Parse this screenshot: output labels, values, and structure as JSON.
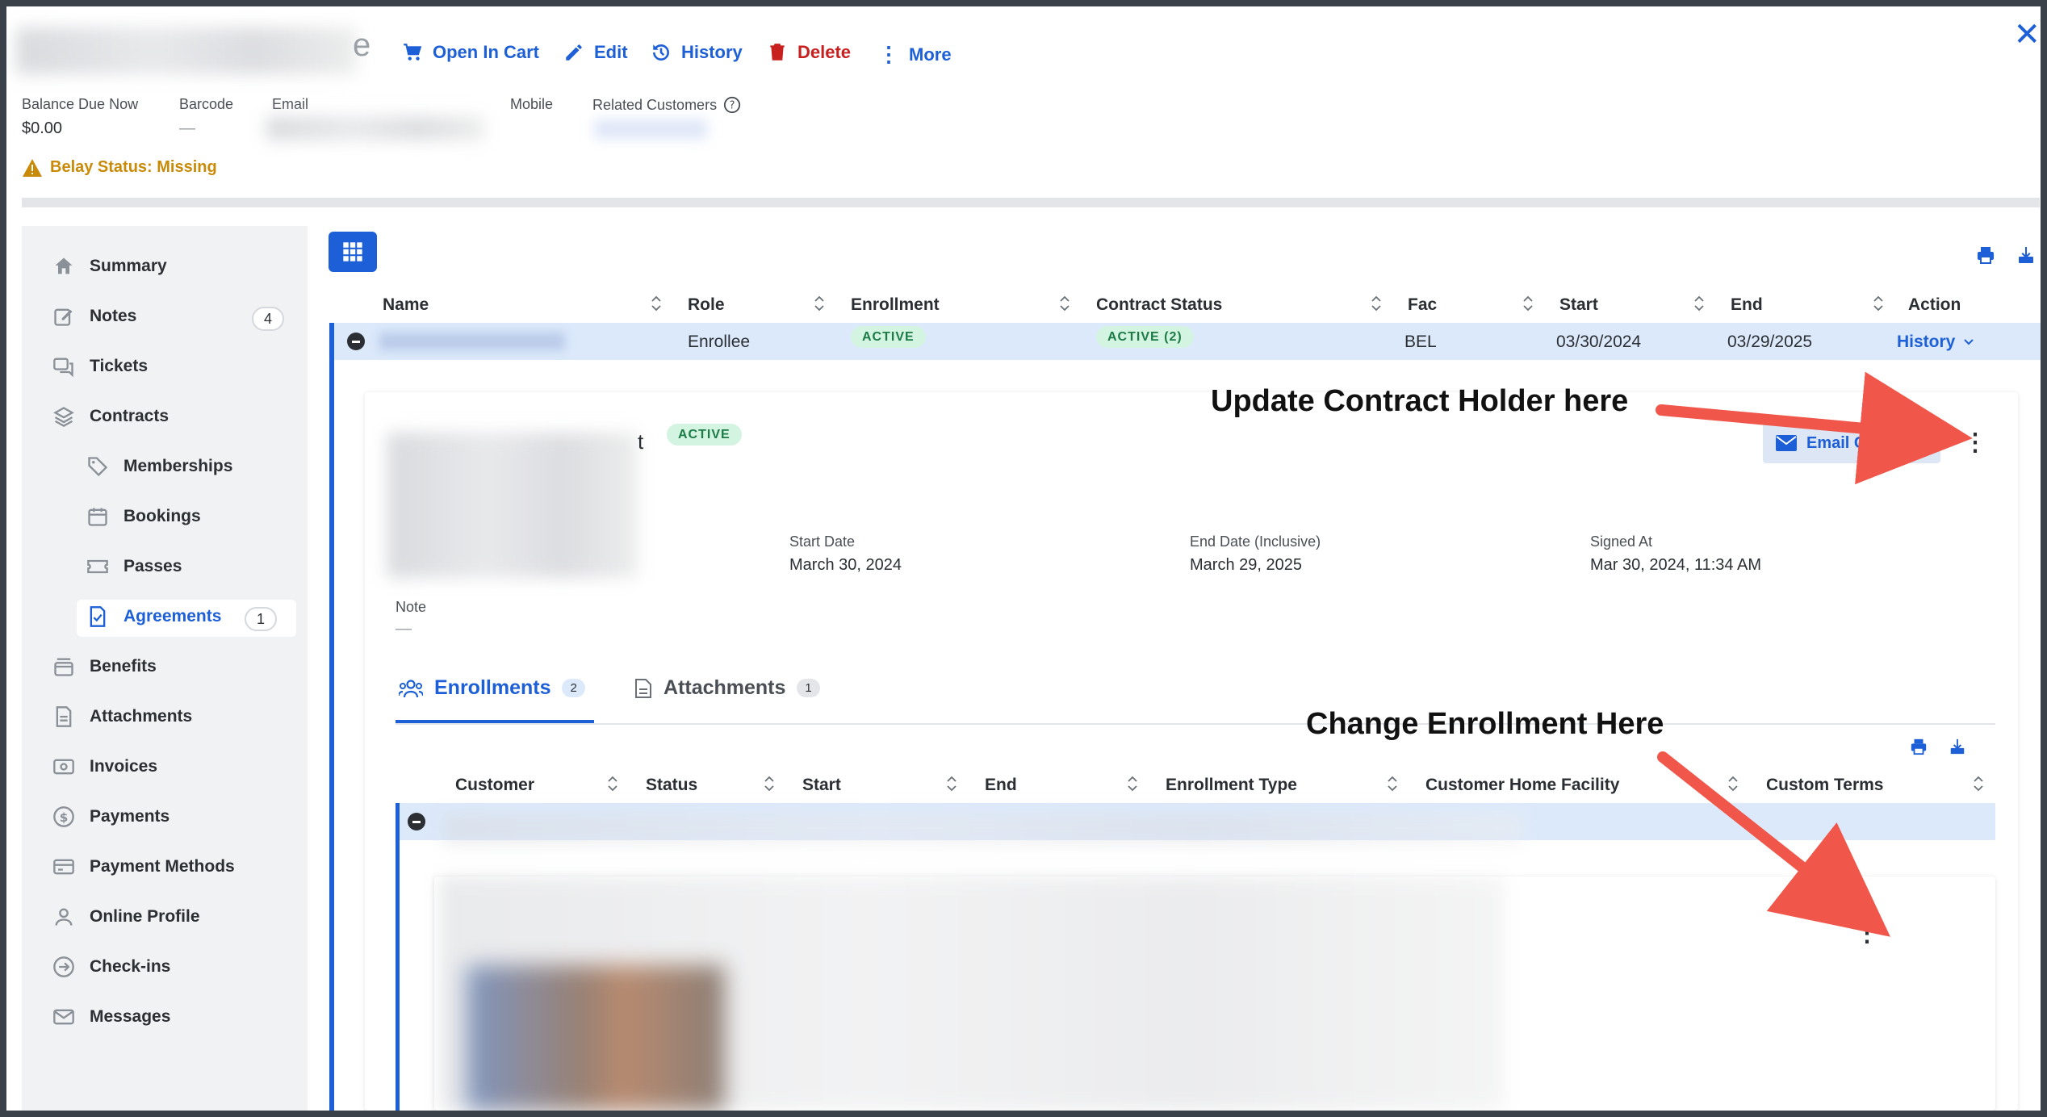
{
  "header": {
    "name_suffix": "e",
    "actions": {
      "open_in_cart": "Open In Cart",
      "edit": "Edit",
      "history": "History",
      "delete": "Delete",
      "more": "More"
    },
    "close": "✕"
  },
  "meta": {
    "balance_label": "Balance Due Now",
    "balance_value": "$0.00",
    "barcode_label": "Barcode",
    "barcode_value": "—",
    "email_label": "Email",
    "mobile_label": "Mobile",
    "related_label": "Related Customers"
  },
  "warning": "Belay Status: Missing",
  "sidebar": {
    "summary": "Summary",
    "notes": "Notes",
    "notes_count": "4",
    "tickets": "Tickets",
    "contracts": "Contracts",
    "memberships": "Memberships",
    "bookings": "Bookings",
    "passes": "Passes",
    "agreements": "Agreements",
    "agreements_count": "1",
    "benefits": "Benefits",
    "attachments": "Attachments",
    "invoices": "Invoices",
    "payments": "Payments",
    "payment_methods": "Payment Methods",
    "online_profile": "Online Profile",
    "checkins": "Check-ins",
    "messages": "Messages"
  },
  "contracts_table": {
    "columns": {
      "name": "Name",
      "role": "Role",
      "enrollment": "Enrollment",
      "contract_status": "Contract Status",
      "fac": "Fac",
      "start": "Start",
      "end": "End",
      "action": "Action"
    },
    "row": {
      "role": "Enrollee",
      "enrollment": "ACTIVE",
      "contract_status": "ACTIVE (2)",
      "fac": "BEL",
      "start": "03/30/2024",
      "end": "03/29/2025",
      "action": "History"
    }
  },
  "contract_detail": {
    "title_fragment": "t",
    "status": "ACTIVE",
    "email_button": "Email Contract",
    "start_label": "Start Date",
    "start_value": "March 30, 2024",
    "end_label": "End Date (Inclusive)",
    "end_value": "March 29, 2025",
    "signed_label": "Signed At",
    "signed_value": "Mar 30, 2024, 11:34 AM",
    "note_label": "Note",
    "note_value": "—"
  },
  "tabs": {
    "enrollments": "Enrollments",
    "enrollments_count": "2",
    "attachments": "Attachments",
    "attachments_count": "1"
  },
  "enrollments_table": {
    "columns": {
      "customer": "Customer",
      "status": "Status",
      "start": "Start",
      "end": "End",
      "enrollment_type": "Enrollment Type",
      "home_facility": "Customer Home Facility",
      "custom_terms": "Custom Terms"
    }
  },
  "annotations": {
    "update_holder": "Update Contract Holder here",
    "change_enrollment": "Change Enrollment Here"
  },
  "colors": {
    "accent": "#1d5fd6",
    "danger": "#c8201f",
    "warning": "#c98a08",
    "arrow": "#f0564a",
    "active_badge_bg": "#d4f4e2"
  }
}
